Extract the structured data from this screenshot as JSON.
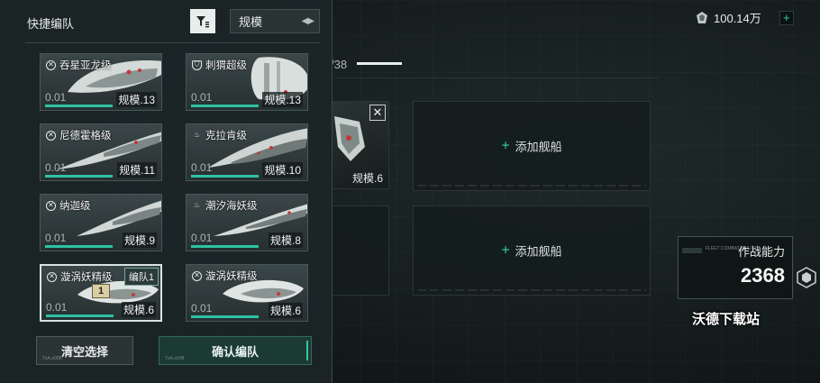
{
  "top_bar": {
    "currency_icon": "gem-icon",
    "currency_value": "100.14万",
    "add_icon": "plus-icon"
  },
  "fleet": {
    "progress_text": "/38",
    "progress_fraction": 0.15,
    "slots": [
      {
        "type": "ship",
        "level": "规模.6",
        "remove_icon": "close-icon"
      },
      {
        "type": "empty",
        "label": "添加舰船"
      },
      {
        "type": "empty",
        "label": ""
      },
      {
        "type": "empty",
        "label": "添加舰船"
      }
    ],
    "combat_power_label": "作战能力",
    "combat_power_value": "2368",
    "power_small_tag": "FLEET COMBAT ABILITY"
  },
  "watermark": "沃德下载站",
  "panel": {
    "title": "快捷编队",
    "filter_icon": "filter-icon",
    "sort_value": "规模",
    "sort_icon": "sort-arrows-icon",
    "cards": [
      {
        "name": "吞星亚龙级",
        "class_icon": "crosshair-icon",
        "value": "0.01",
        "level": "规模.13"
      },
      {
        "name": "刺猬超级",
        "class_icon": "shield-icon",
        "value": "0.01",
        "level": "规模.13"
      },
      {
        "name": "尼德霍格级",
        "class_icon": "crosshair-icon",
        "value": "0.01",
        "level": "规模.11"
      },
      {
        "name": "克拉肯级",
        "class_icon": "flame-icon",
        "value": "0.01",
        "level": "规模.10"
      },
      {
        "name": "纳迦级",
        "class_icon": "crosshair-icon",
        "value": "0.01",
        "level": "规模.9"
      },
      {
        "name": "潮汐海妖级",
        "class_icon": "flame-icon",
        "value": "0.01",
        "level": "规模.8"
      },
      {
        "name": "漩涡妖精级",
        "class_icon": "crosshair-icon",
        "value": "0.01",
        "level": "规模.6",
        "team": "编队1",
        "slot": "1",
        "selected": true
      },
      {
        "name": "漩涡妖精级",
        "class_icon": "crosshair-icon",
        "value": "0.01",
        "level": "规模.6"
      }
    ],
    "clear_label": "清空选择",
    "confirm_label": "确认编队",
    "btn_tiny": "TxA.e008"
  },
  "colors": {
    "accent": "#2fc2a3",
    "bg": "#141b1c",
    "panel": "#1c2526"
  }
}
